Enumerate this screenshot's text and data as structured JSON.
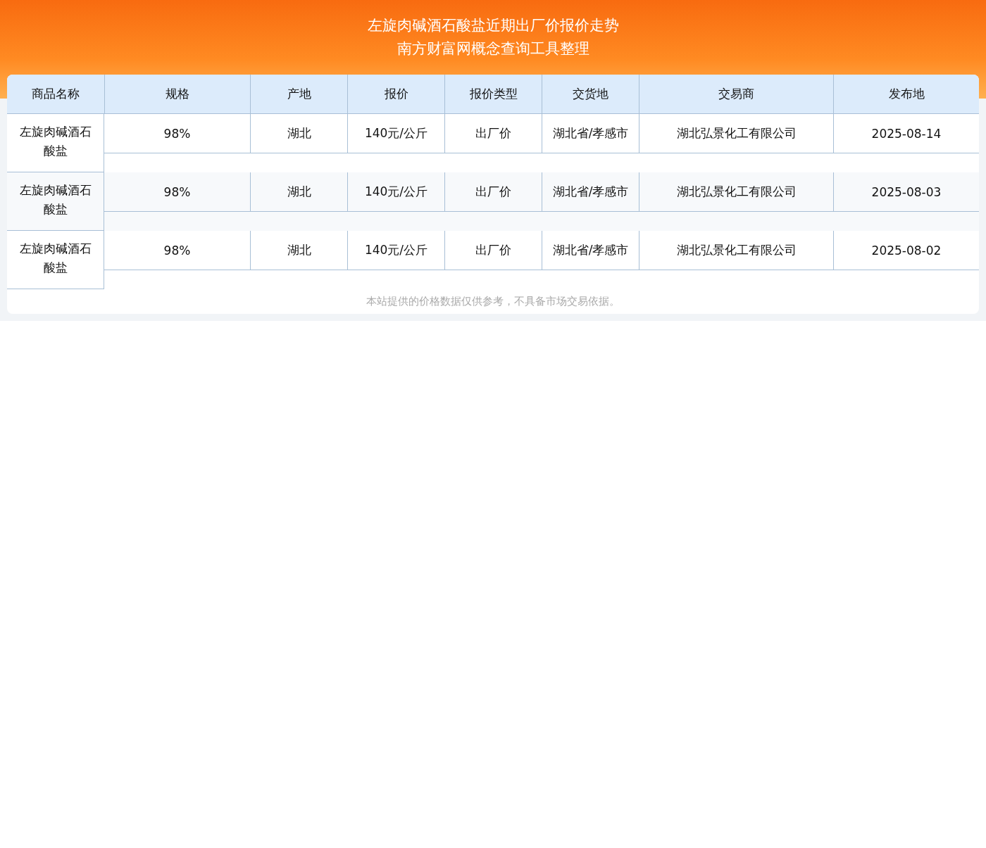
{
  "header": {
    "title": "左旋肉碱酒石酸盐近期出厂价报价走势",
    "subtitle": "南方财富网概念查询工具整理"
  },
  "table": {
    "columns": [
      "商品名称",
      "规格",
      "产地",
      "报价",
      "报价类型",
      "交货地",
      "交易商",
      "发布地"
    ],
    "rows": [
      {
        "cells": [
          "左旋肉碱酒石酸盐",
          "98%",
          "湖北",
          "140元/公斤",
          "出厂价",
          "湖北省/孝感市",
          "湖北弘景化工有限公司",
          "2025-08-14"
        ]
      },
      {
        "cells": [
          "左旋肉碱酒石酸盐",
          "98%",
          "湖北",
          "140元/公斤",
          "出厂价",
          "湖北省/孝感市",
          "湖北弘景化工有限公司",
          "2025-08-03"
        ]
      },
      {
        "cells": [
          "左旋肉碱酒石酸盐",
          "98%",
          "湖北",
          "140元/公斤",
          "出厂价",
          "湖北省/孝感市",
          "湖北弘景化工有限公司",
          "2025-08-02"
        ]
      }
    ]
  },
  "footer_note": "本站提供的价格数据仅供参考，不具备市场交易依据。"
}
